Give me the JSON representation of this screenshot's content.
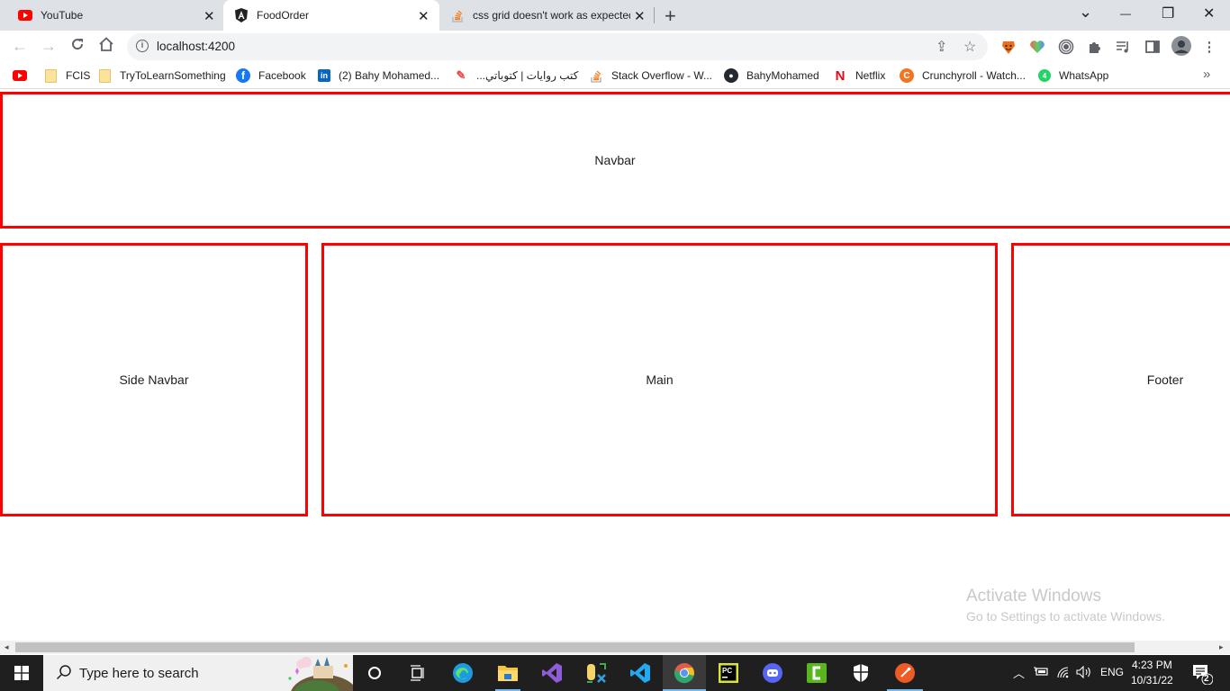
{
  "browser": {
    "tabs": [
      {
        "title": "YouTube",
        "icon": "youtube-icon",
        "active": false
      },
      {
        "title": "FoodOrder",
        "icon": "angular-icon",
        "active": true
      },
      {
        "title": "css grid doesn't work as expected",
        "icon": "stackoverflow-icon",
        "active": false
      }
    ],
    "tab_close_glyph": "✕",
    "new_tab_glyph": "+",
    "window_controls": {
      "tab_search": "⌄",
      "minimize": "—",
      "restore": "❐",
      "close": "✕"
    },
    "url": "localhost:4200",
    "bookmarks": [
      {
        "label": "",
        "icon": "youtube-icon"
      },
      {
        "label": "FCIS",
        "icon": "folder-icon"
      },
      {
        "label": "TryToLearnSomething",
        "icon": "folder-icon"
      },
      {
        "label": "Facebook",
        "icon": "facebook-icon"
      },
      {
        "label": "(2) Bahy Mohamed...",
        "icon": "linkedin-icon"
      },
      {
        "label": "كتب روايات | كتوباتي...",
        "icon": "kotobati-icon"
      },
      {
        "label": "Stack Overflow - W...",
        "icon": "stackoverflow-icon"
      },
      {
        "label": "BahyMohamed",
        "icon": "github-icon"
      },
      {
        "label": "Netflix",
        "icon": "netflix-icon"
      },
      {
        "label": "Crunchyroll - Watch...",
        "icon": "crunchyroll-icon"
      },
      {
        "label": "WhatsApp",
        "icon": "whatsapp-icon"
      }
    ],
    "bookmarks_overflow": "»"
  },
  "page": {
    "navbar_label": "Navbar",
    "side_navbar_label": "Side Navbar",
    "main_label": "Main",
    "footer_label": "Footer",
    "border_color": "#ff0000"
  },
  "watermark": {
    "title": "Activate Windows",
    "subtitle": "Go to Settings to activate Windows."
  },
  "taskbar": {
    "search_placeholder": "Type here to search",
    "apps": [
      "cortana",
      "task-view",
      "edge",
      "file-explorer",
      "visual-studio",
      "sql-tool",
      "vscode",
      "chrome",
      "pycharm",
      "discord",
      "camtasia",
      "security",
      "postman"
    ],
    "tray": {
      "language": "ENG",
      "time": "4:23 PM",
      "date": "10/31/22",
      "notification_count": "2"
    }
  }
}
